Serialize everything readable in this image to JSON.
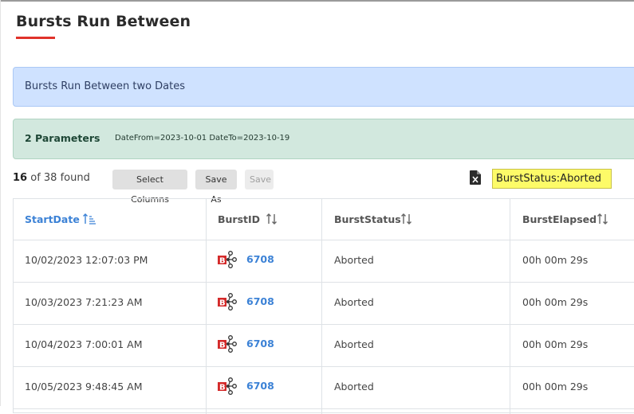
{
  "page": {
    "title": "Bursts Run Between",
    "accent_color": "#e0322a"
  },
  "info": {
    "text": "Bursts Run Between two Dates"
  },
  "parameters": {
    "title": "2 Parameters",
    "values": "DateFrom=2023-10-01 DateTo=2023-10-19"
  },
  "results": {
    "count": "16",
    "of_text": "of 38 found"
  },
  "toolbar": {
    "select_columns": "Select Columns",
    "save_as": "Save As",
    "save": "Save",
    "excel_icon": "excel-export-icon",
    "filter_value": "BurstStatus:Aborted"
  },
  "table": {
    "columns": [
      {
        "label": "StartDate",
        "sort": "ascending-active"
      },
      {
        "label": "BurstID",
        "sort": "unsorted"
      },
      {
        "label": "BurstStatus",
        "sort": "unsorted"
      },
      {
        "label": "BurstElapsed",
        "sort": "unsorted"
      }
    ],
    "rows": [
      {
        "start_date": "10/02/2023 12:07:03 PM",
        "burst_id": "6708",
        "status": "Aborted",
        "elapsed": "00h 00m 29s"
      },
      {
        "start_date": "10/03/2023 7:21:23 AM",
        "burst_id": "6708",
        "status": "Aborted",
        "elapsed": "00h 00m 29s"
      },
      {
        "start_date": "10/04/2023 7:00:01 AM",
        "burst_id": "6708",
        "status": "Aborted",
        "elapsed": "00h 00m 29s"
      },
      {
        "start_date": "10/05/2023 9:48:45 AM",
        "burst_id": "6708",
        "status": "Aborted",
        "elapsed": "00h 00m 29s"
      }
    ],
    "link_color": "#3c82d6"
  }
}
